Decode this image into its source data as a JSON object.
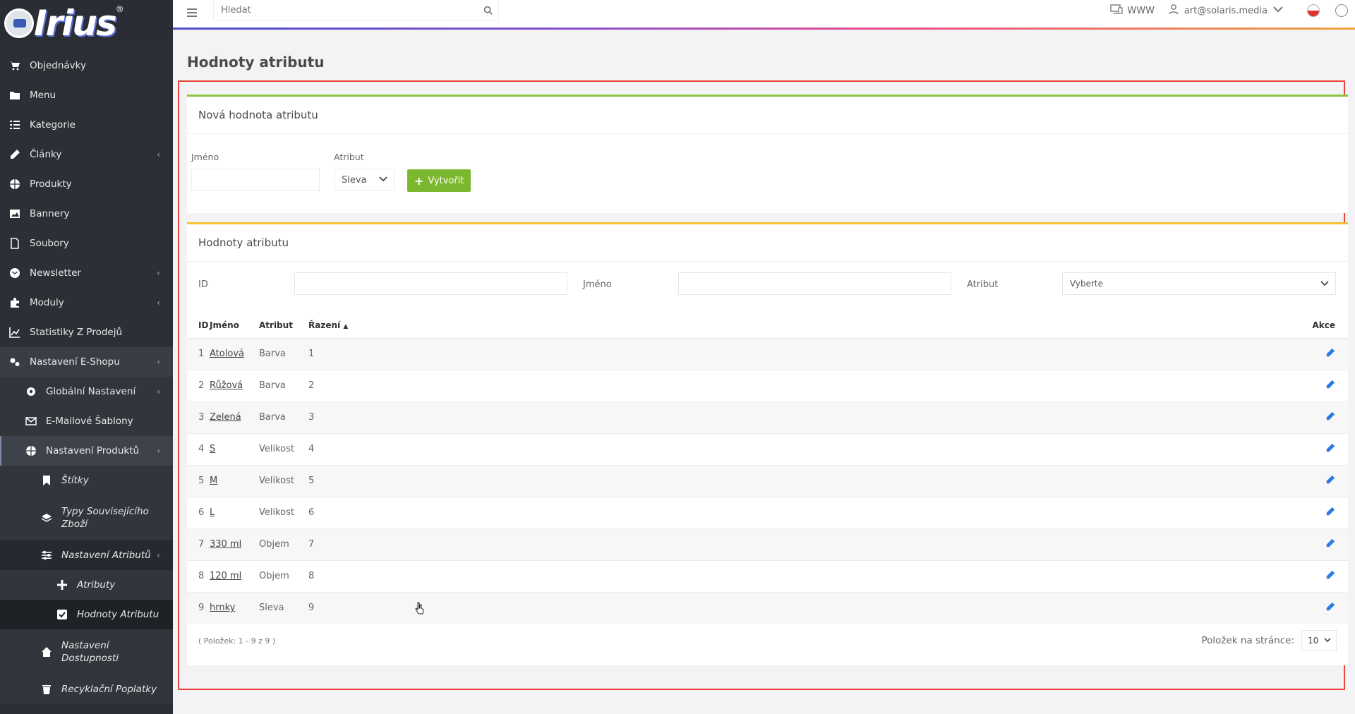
{
  "brand": {
    "logo_text": "Irius",
    "logo_mark": "®"
  },
  "topbar": {
    "search_placeholder": "Hledat",
    "www_label": "WWW",
    "user_email": "art@solaris.media"
  },
  "sidebar": {
    "items": [
      {
        "label": "Objednávky",
        "icon": "cart-icon"
      },
      {
        "label": "Menu",
        "icon": "folder-icon"
      },
      {
        "label": "Kategorie",
        "icon": "list-icon"
      },
      {
        "label": "Články",
        "icon": "pencil-icon",
        "chevron": "‹"
      },
      {
        "label": "Produkty",
        "icon": "basketball-icon"
      },
      {
        "label": "Bannery",
        "icon": "image-icon"
      },
      {
        "label": "Soubory",
        "icon": "file-icon"
      },
      {
        "label": "Newsletter",
        "icon": "email-icon",
        "chevron": "‹"
      },
      {
        "label": "Moduly",
        "icon": "puzzle-icon",
        "chevron": "‹"
      },
      {
        "label": "Statistiky Z Prodejů",
        "icon": "chart-icon"
      },
      {
        "label": "Nastavení E-Shopu",
        "icon": "cogs-icon",
        "chevron": "‹"
      }
    ],
    "sub_items": [
      {
        "label": "Globální Nastavení",
        "icon": "gear-icon",
        "chevron": "‹"
      },
      {
        "label": "E-Mailové Šablony",
        "icon": "envelope-icon"
      },
      {
        "label": "Nastavení Produktů",
        "icon": "basketball-icon",
        "chevron": "‹"
      }
    ],
    "sub_sub_items": [
      {
        "label": "Štítky",
        "icon": "bookmark-icon"
      },
      {
        "label": "Typy Souvisejícího Zboží",
        "icon": "layers-icon"
      },
      {
        "label": "Nastavení Atributů",
        "icon": "sliders-icon",
        "chevron": "‹"
      }
    ],
    "attr_items": [
      {
        "label": "Atributy",
        "icon": "plus-icon"
      },
      {
        "label": "Hodnoty Atributu",
        "icon": "checkbox-icon"
      }
    ],
    "tail_items": [
      {
        "label": "Nastavení Dostupnosti",
        "icon": "home-icon"
      },
      {
        "label": "Recyklační Poplatky",
        "icon": "trash-icon"
      }
    ]
  },
  "page": {
    "title": "Hodnoty atributu"
  },
  "new_value": {
    "heading": "Nová hodnota atributu",
    "name_label": "Jméno",
    "attr_label": "Atribut",
    "attr_selected": "Sleva",
    "create_button": "Vytvořit"
  },
  "list": {
    "heading": "Hodnoty atributu",
    "filter_id_label": "ID",
    "filter_name_label": "Jméno",
    "filter_attr_label": "Atribut",
    "filter_attr_selected": "Vyberte",
    "columns": {
      "id": "ID",
      "name": "Jméno",
      "attr": "Atribut",
      "sort": "Řazení",
      "actions": "Akce"
    },
    "rows": [
      {
        "id": "1",
        "name": "Atolová",
        "attr": "Barva",
        "sort": "1"
      },
      {
        "id": "2",
        "name": "Růžová",
        "attr": "Barva",
        "sort": "2"
      },
      {
        "id": "3",
        "name": "Zelená",
        "attr": "Barva",
        "sort": "3"
      },
      {
        "id": "4",
        "name": "S",
        "attr": "Velikost",
        "sort": "4"
      },
      {
        "id": "5",
        "name": "M",
        "attr": "Velikost",
        "sort": "5"
      },
      {
        "id": "6",
        "name": "L",
        "attr": "Velikost",
        "sort": "6"
      },
      {
        "id": "7",
        "name": "330 ml",
        "attr": "Objem",
        "sort": "7"
      },
      {
        "id": "8",
        "name": "120 ml",
        "attr": "Objem",
        "sort": "8"
      },
      {
        "id": "9",
        "name": "hrnky",
        "attr": "Sleva",
        "sort": "9"
      }
    ],
    "footer_info": "( Položek: 1 - 9 z 9 )",
    "per_page_label": "Položek na stránce:",
    "per_page_value": "10"
  },
  "colors": {
    "sidebar_bg": "#2c2f36",
    "create_button": "#7cb82f",
    "new_card_accent": "#8cc63f",
    "list_card_accent": "#f1c232",
    "highlight_border": "#e8443b",
    "edit_icon": "#2a7ae2"
  }
}
